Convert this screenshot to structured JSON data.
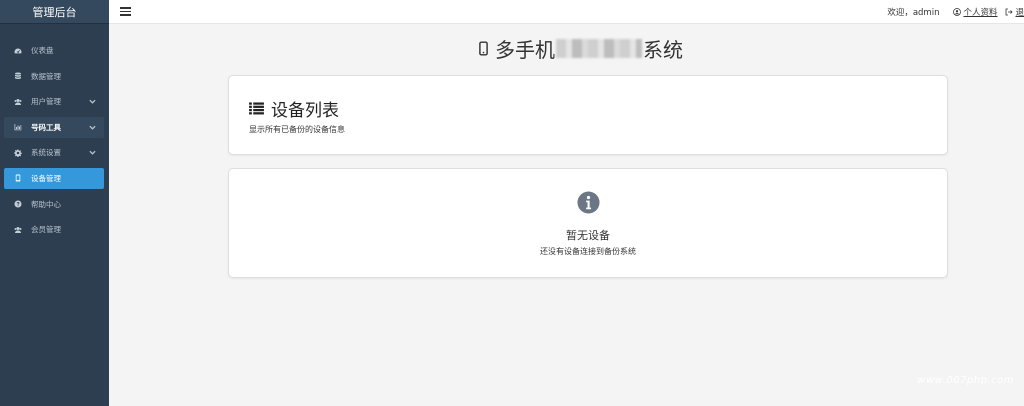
{
  "sidebar": {
    "brand": "管理后台",
    "items": [
      {
        "label": "仪表盘",
        "icon": "dashboard-icon"
      },
      {
        "label": "数据管理",
        "icon": "database-icon"
      },
      {
        "label": "用户管理",
        "icon": "users-icon",
        "has_submenu": true
      },
      {
        "label": "号码工具",
        "icon": "chart-icon",
        "has_submenu": true,
        "state": "open"
      },
      {
        "label": "系统设置",
        "icon": "gear-icon",
        "has_submenu": true
      },
      {
        "label": "设备管理",
        "icon": "mobile-icon",
        "state": "active"
      },
      {
        "label": "帮助中心",
        "icon": "help-icon"
      },
      {
        "label": "会员管理",
        "icon": "users-icon"
      }
    ]
  },
  "topbar": {
    "welcome": "欢迎，admin",
    "profile_label": "个人资料",
    "logout_label": "退"
  },
  "page": {
    "title_prefix": "多手机",
    "title_suffix": "系统"
  },
  "device_list": {
    "title": "设备列表",
    "subtitle": "显示所有已备份的设备信息"
  },
  "empty_state": {
    "title": "暂无设备",
    "description": "还没有设备连接到备份系统"
  },
  "watermark": "www.007php.com",
  "colors": {
    "sidebar_bg": "#2c3e50",
    "active_item": "#3498db",
    "page_bg": "#f4f4f4"
  }
}
